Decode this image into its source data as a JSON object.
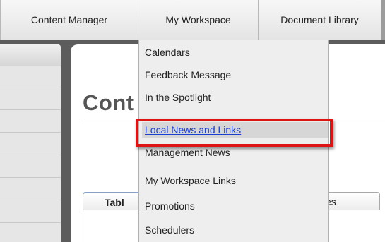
{
  "nav": {
    "tabs": [
      "Content Manager",
      "My Workspace",
      "Document Library"
    ]
  },
  "dropdown": {
    "items": [
      "Calendars",
      "Feedback Message",
      "In the Spotlight",
      "Local News and Links",
      "Management News",
      "My Workspace Links",
      "Promotions",
      "Schedulers"
    ],
    "selected_index": 3
  },
  "main": {
    "title": "Cont",
    "subtabs": [
      "Tabl",
      "es"
    ]
  },
  "colors": {
    "highlight_border": "#dd1414",
    "link": "#1b3fd1",
    "frame": "#5c5c5c"
  }
}
